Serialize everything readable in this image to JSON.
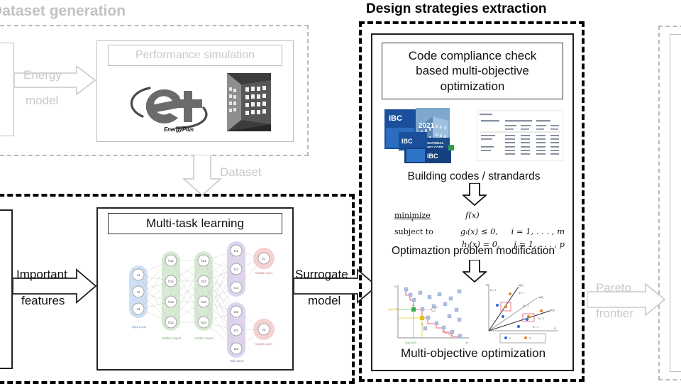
{
  "figure": {
    "type": "flowchart-diagram",
    "description": "Research framework flowchart: dataset generation, multi-task learning surrogate model, and design strategies extraction"
  },
  "panels": {
    "dataset_generation": {
      "title": "Dataset generation",
      "inner_title": "Performance simulation",
      "logo_text": "EnergyPlus",
      "logo_mark": "e+",
      "arrow_in_line1": "Energy",
      "arrow_in_line2": "model",
      "arrow_out_label": "Dataset"
    },
    "multi_task_learning": {
      "title": "Multi-task learning",
      "arrow_in_line1": "Important",
      "arrow_in_line2": "features",
      "arrow_out_line1": "Surrogate",
      "arrow_out_line2": "model",
      "network": {
        "input_layer_label": "Input Layer",
        "hidden_layer1_label": "Hidden Layer1",
        "hidden_layer2_label": "Hidden Layer2",
        "task_layer_label": "Task Layer",
        "output_layer_label": "Output Layer",
        "output_layer2_label": "Output Layer",
        "input_nodes": [
          "x₁",
          "x₂",
          "x₃"
        ],
        "hidden1_nodes": [
          "h₁₁",
          "h₁₂",
          "h₁₃",
          "h₁₄"
        ],
        "hidden2_nodes": [
          "h₂₁",
          "h₂₂",
          "h₂₃",
          "h₂₄"
        ],
        "task1_nodes": [
          "t₁₁",
          "t₁₂",
          "t₁₃"
        ],
        "task2_nodes": [
          "t₂₁",
          "t₂₂",
          "t₂₃"
        ],
        "output_nodes": [
          "y₁",
          "y₂"
        ]
      }
    },
    "design_strategies": {
      "title": "Design strategies extraction",
      "header_line1": "Code compliance check",
      "header_line2": "based multi-objective",
      "header_line3": "optimization",
      "caption_codes": "Building codes / strandards",
      "caption_problem": "Optimaztion problem modification",
      "caption_mopt": "Multi-objective optimization",
      "book_label": "IBC",
      "book_year": "2021",
      "math": {
        "minimize_kw": "minimize",
        "minimize_var": "x",
        "objective": "f(x)",
        "subject_kw": "subject to",
        "constraint1": "gᵢ(x) ≤ 0,",
        "constraint1_range": "i = 1, . . . , m",
        "constraint2": "hⱼ(x) = 0,",
        "constraint2_range": "j = 1, . . . , p"
      },
      "pareto_chart": {
        "annotation": "Pareto",
        "legend_a": "A",
        "legend_b": "B",
        "legend_c": "C"
      },
      "ray_chart": {
        "legend_item1": "1",
        "legend_item2": "2"
      }
    },
    "right_panel": {
      "arrow_line1": "Pareto",
      "arrow_line2": "frontier"
    }
  },
  "colors": {
    "grey_dash": "#b9b9b9",
    "grey_text": "#c2c2c2",
    "black": "#000000",
    "input_layer": "#bcd5ef",
    "hidden_layer": "#c9e3c4",
    "task_layer": "#d6c9e8",
    "output_layer": "#f3c6c6",
    "pareto_point": "#aebfe0",
    "pareto_line": "#e8697d",
    "ray_blue": "#2f6fd0",
    "ray_orange": "#e8832a",
    "book_blue": "#1b4f9c"
  },
  "chart_data": [
    {
      "type": "scatter",
      "name": "pareto-frontier-plot",
      "title": "",
      "xlabel": "f₁",
      "ylabel": "f₂",
      "annotation": "Pareto",
      "points_x": [
        8,
        12,
        14,
        18,
        22,
        26,
        30,
        34,
        38,
        42,
        46,
        50,
        55,
        60,
        65,
        70,
        75,
        80,
        86,
        90
      ],
      "points_y": [
        95,
        88,
        75,
        70,
        84,
        60,
        78,
        55,
        66,
        45,
        72,
        40,
        58,
        33,
        50,
        28,
        44,
        22,
        36,
        15
      ],
      "frontier_x": [
        8,
        10,
        14,
        18,
        24,
        30,
        38,
        46,
        56,
        66,
        76,
        86
      ],
      "frontier_y": [
        95,
        82,
        75,
        62,
        55,
        48,
        42,
        34,
        30,
        24,
        20,
        15
      ],
      "grid": false,
      "legend": "none"
    },
    {
      "type": "scatter",
      "name": "reference-ray-plot",
      "title": "",
      "xlabel": "f₁",
      "ylabel": "f₂",
      "series": [
        {
          "name": "1",
          "color": "#2f6fd0",
          "x": [
            22,
            38,
            46,
            62,
            70
          ],
          "y": [
            62,
            40,
            72,
            30,
            18
          ]
        },
        {
          "name": "2",
          "color": "#e8832a",
          "x": [
            40,
            48,
            66,
            80
          ],
          "y": [
            80,
            58,
            40,
            36
          ]
        }
      ],
      "rays": 3,
      "grid": false,
      "legend": "bottom"
    }
  ]
}
